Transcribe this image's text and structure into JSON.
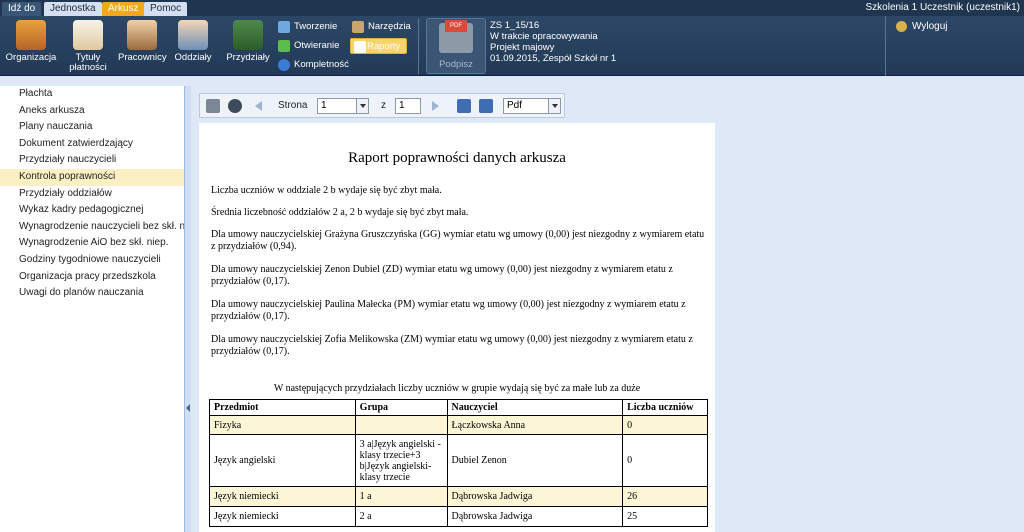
{
  "menubar": {
    "tabs": [
      {
        "label": "Idź do"
      },
      {
        "label": "Jednostka"
      },
      {
        "label": "Arkusz"
      },
      {
        "label": "Pomoc"
      }
    ],
    "user": "Szkolenia 1 Uczestnik (uczestnik1)"
  },
  "ribbon": {
    "organizacja": "Organizacja",
    "tytuly": "Tytuły",
    "platnosci": "płatności",
    "pracownicy": "Pracownicy",
    "oddzialy": "Oddziały",
    "przydzialy": "Przydziały",
    "tworzenie": "Tworzenie",
    "otwieranie": "Otwieranie",
    "kompletnosc": "Kompletność",
    "narzedzia": "Narzędzia",
    "raporty": "Raporty",
    "podpisz": "Podpisz",
    "pdf_badge": "PDF",
    "doc_info": {
      "line1": "ZS 1_15/16",
      "line2": "W trakcie opracowywania",
      "line3": "Projekt majowy",
      "line4": "01.09.2015, Zespół Szkół nr 1"
    },
    "logout": "Wyloguj"
  },
  "sidebar": {
    "items": [
      {
        "label": "Płachta"
      },
      {
        "label": "Aneks arkusza"
      },
      {
        "label": "Plany nauczania"
      },
      {
        "label": "Dokument zatwierdzający"
      },
      {
        "label": "Przydziały nauczycieli"
      },
      {
        "label": "Kontrola poprawności"
      },
      {
        "label": "Przydziały oddziałów"
      },
      {
        "label": "Wykaz kadry pedagogicznej"
      },
      {
        "label": "Wynagrodzenie nauczycieli bez skł. niep."
      },
      {
        "label": "Wynagrodzenie AiO bez skł. niep."
      },
      {
        "label": "Godziny tygodniowe nauczycieli"
      },
      {
        "label": "Organizacja pracy przedszkola"
      },
      {
        "label": "Uwagi do planów nauczania"
      }
    ],
    "active_index": 5
  },
  "toolbar": {
    "strona_label": "Strona",
    "page_value": "1",
    "of_label": "z",
    "total_pages": "1",
    "format_value": "Pdf"
  },
  "report": {
    "title": "Raport poprawności danych arkusza",
    "paragraphs": [
      "Liczba uczniów w oddziale 2 b wydaje się być zbyt mała.",
      "Średnia liczebność oddziałów 2 a, 2 b wydaje się być zbyt mała.",
      "Dla umowy nauczycielskiej Grażyna Gruszczyńska (GG) wymiar etatu wg umowy (0,00) jest niezgodny z wymiarem etatu z przydziałów (0,94).",
      "Dla umowy nauczycielskiej Zenon Dubiel (ZD) wymiar etatu wg umowy (0,00) jest niezgodny z wymiarem etatu z przydziałów (0,17).",
      "Dla umowy nauczycielskiej Paulina Małecka (PM) wymiar etatu wg umowy (0,00) jest niezgodny z wymiarem etatu z przydziałów (0,17).",
      "Dla umowy nauczycielskiej Zofia Melikowska (ZM) wymiar etatu wg umowy (0,00) jest niezgodny z wymiarem etatu z przydziałów (0,17)."
    ],
    "table_caption": "W następujących przydziałach liczby uczniów w grupie wydają się być za małe lub za duże",
    "table": {
      "headers": [
        "Przedmiot",
        "Grupa",
        "Nauczyciel",
        "Liczba uczniów"
      ],
      "rows": [
        [
          "Fizyka",
          "",
          "Łączkowska Anna",
          "0"
        ],
        [
          "Język angielski",
          "3 a|Język angielski - klasy trzecie+3 b|Język angielski-klasy trzecie",
          "Dubiel Zenon",
          "0"
        ],
        [
          "Język niemiecki",
          "1 a",
          "Dąbrowska Jadwiga",
          "26"
        ],
        [
          "Język niemiecki",
          "2 a",
          "Dąbrowska Jadwiga",
          "25"
        ]
      ]
    }
  }
}
